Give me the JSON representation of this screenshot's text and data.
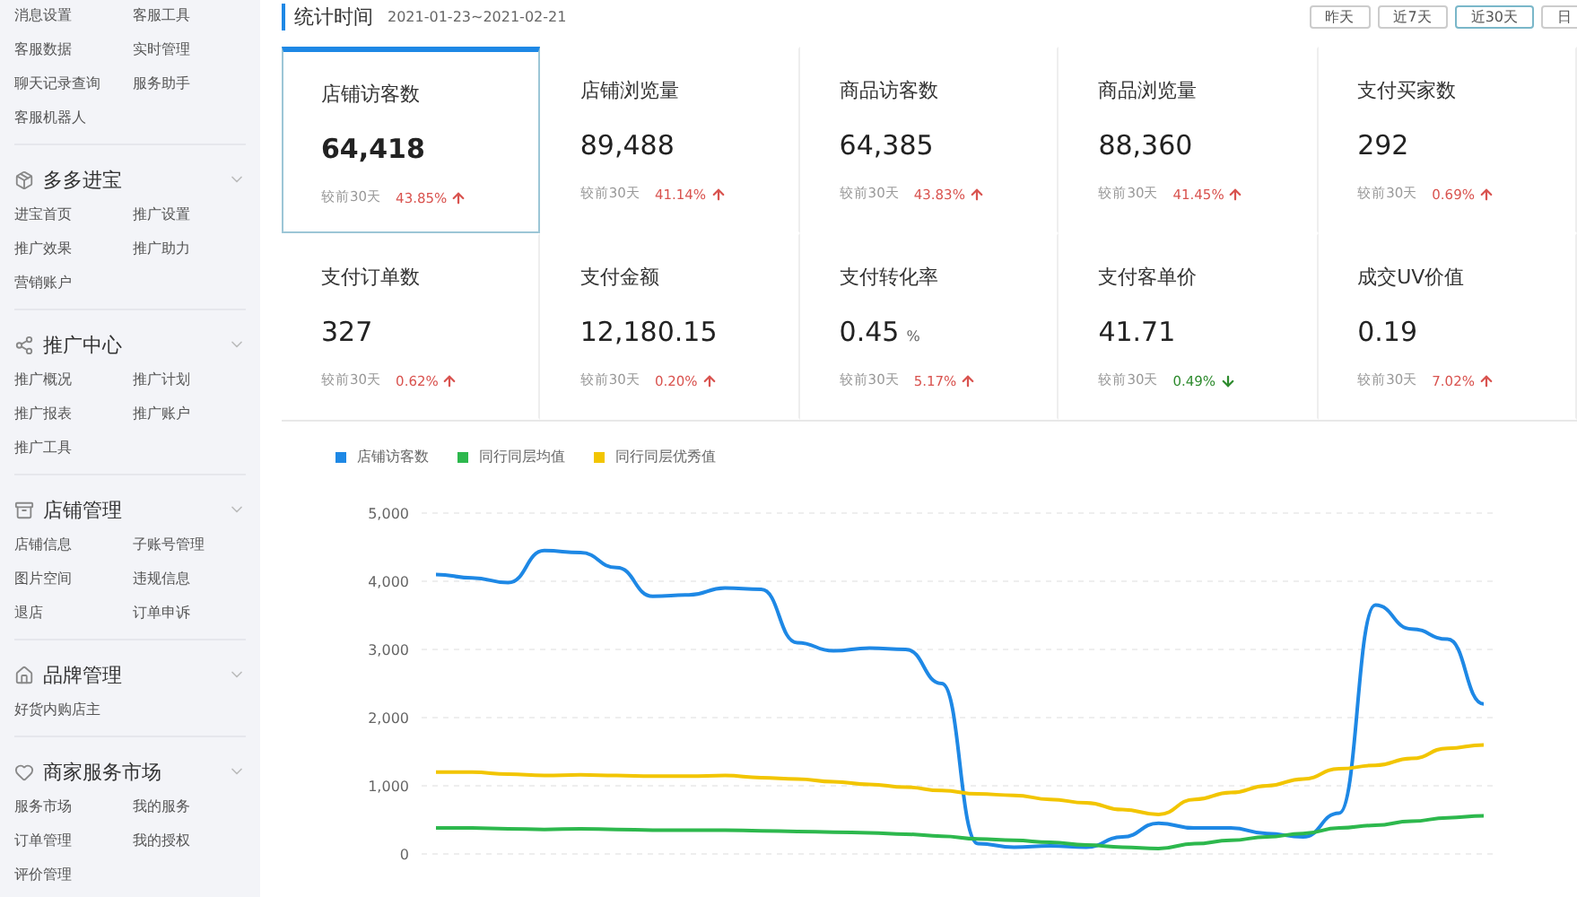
{
  "sidebar": {
    "sections": [
      {
        "items": [
          "消息设置",
          "客服工具",
          "客服数据",
          "实时管理",
          "聊天记录查询",
          "服务助手",
          "客服机器人"
        ]
      },
      {
        "title": "多多进宝",
        "items": [
          "进宝首页",
          "推广设置",
          "推广效果",
          "推广助力",
          "营销账户"
        ]
      },
      {
        "title": "推广中心",
        "items": [
          "推广概况",
          "推广计划",
          "推广报表",
          "推广账户",
          "推广工具"
        ]
      },
      {
        "title": "店铺管理",
        "items": [
          "店铺信息",
          "子账号管理",
          "图片空间",
          "违规信息",
          "退店",
          "订单申诉"
        ]
      },
      {
        "title": "品牌管理",
        "items": [
          "好货内购店主"
        ]
      },
      {
        "title": "商家服务市场",
        "items": [
          "服务市场",
          "我的服务",
          "订单管理",
          "我的授权",
          "评价管理"
        ]
      }
    ]
  },
  "header": {
    "title": "统计时间",
    "date_range": "2021-01-23~2021-02-21",
    "ranges": [
      {
        "label": "昨天",
        "selected": false
      },
      {
        "label": "近7天",
        "selected": false
      },
      {
        "label": "近30天",
        "selected": true
      },
      {
        "label": "日",
        "selected": false
      }
    ]
  },
  "metrics": [
    {
      "label": "店铺访客数",
      "value": "64,418",
      "compare": "较前30天",
      "change": "43.85%",
      "kind": "increase",
      "selected": true
    },
    {
      "label": "店铺浏览量",
      "value": "89,488",
      "compare": "较前30天",
      "change": "41.14%",
      "kind": "increase",
      "selected": false
    },
    {
      "label": "商品访客数",
      "value": "64,385",
      "compare": "较前30天",
      "change": "43.83%",
      "kind": "increase",
      "selected": false
    },
    {
      "label": "商品浏览量",
      "value": "88,360",
      "compare": "较前30天",
      "change": "41.45%",
      "kind": "increase",
      "selected": false
    },
    {
      "label": "支付买家数",
      "value": "292",
      "compare": "较前30天",
      "change": "0.69%",
      "kind": "increase",
      "selected": false
    },
    {
      "label": "支付订单数",
      "value": "327",
      "compare": "较前30天",
      "change": "0.62%",
      "kind": "increase",
      "selected": false
    },
    {
      "label": "支付金额",
      "value": "12,180.15",
      "compare": "较前30天",
      "change": "0.20%",
      "kind": "increase",
      "selected": false
    },
    {
      "label": "支付转化率",
      "value": "0.45",
      "unit": "%",
      "compare": "较前30天",
      "change": "5.17%",
      "kind": "increase",
      "selected": false
    },
    {
      "label": "支付客单价",
      "value": "41.71",
      "compare": "较前30天",
      "change": "0.49%",
      "kind": "decrease",
      "selected": false
    },
    {
      "label": "成交UV价值",
      "value": "0.19",
      "compare": "较前30天",
      "change": "7.02%",
      "kind": "increase",
      "selected": false
    }
  ],
  "trend": {
    "chart_data": {
      "type": "line",
      "grid": true,
      "ylim": [
        0,
        5000
      ],
      "yticks": [
        {
          "value": 0,
          "label": "0"
        },
        {
          "value": 1000,
          "label": "1,000"
        },
        {
          "value": 2000,
          "label": "2,000"
        },
        {
          "value": 3000,
          "label": "3,000"
        },
        {
          "value": 4000,
          "label": "4,000"
        },
        {
          "value": 5000,
          "label": "5,000"
        }
      ],
      "series": [
        {
          "name": "店铺访客数",
          "color": "#1e88e5",
          "values": [
            4100,
            4050,
            3980,
            4450,
            4420,
            4200,
            3780,
            3800,
            3900,
            3880,
            3100,
            2980,
            3020,
            3000,
            2500,
            150,
            100,
            120,
            100,
            250,
            450,
            380,
            380,
            300,
            250,
            600,
            3650,
            3300,
            3150,
            2200
          ]
        },
        {
          "name": "同行同层均值",
          "color": "#2db84d",
          "values": [
            380,
            380,
            370,
            360,
            370,
            360,
            350,
            350,
            350,
            340,
            330,
            320,
            310,
            290,
            260,
            220,
            200,
            170,
            130,
            100,
            80,
            150,
            200,
            250,
            300,
            380,
            420,
            480,
            530,
            560
          ]
        },
        {
          "name": "同行同层优秀值",
          "color": "#f2c500",
          "values": [
            1200,
            1200,
            1170,
            1150,
            1160,
            1150,
            1140,
            1140,
            1150,
            1120,
            1100,
            1060,
            1020,
            980,
            930,
            880,
            860,
            800,
            750,
            650,
            580,
            800,
            900,
            1000,
            1100,
            1250,
            1300,
            1400,
            1550,
            1600
          ]
        }
      ]
    }
  }
}
